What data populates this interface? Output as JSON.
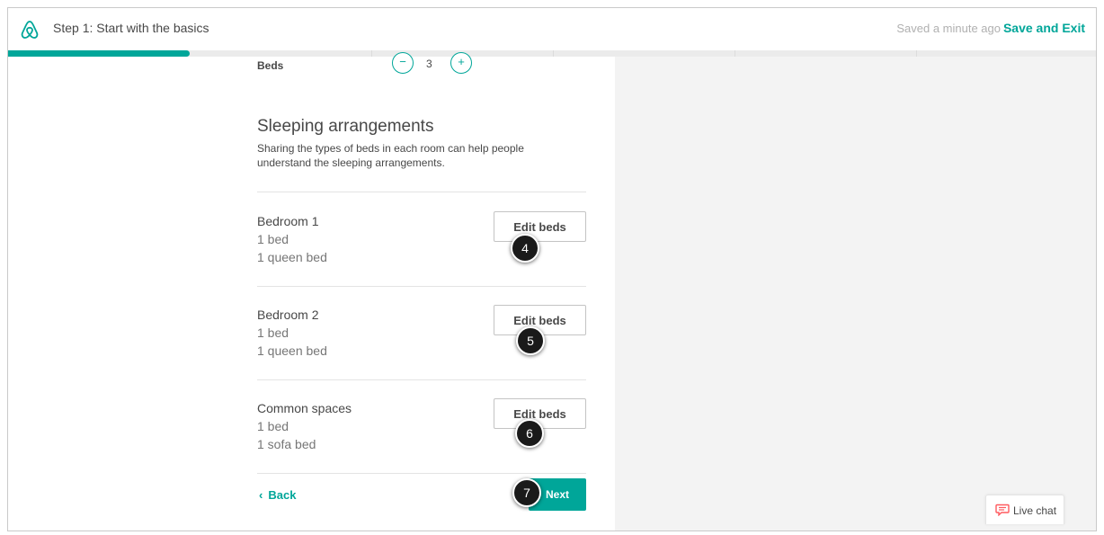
{
  "header": {
    "step_title": "Step 1: Start with the basics",
    "saved_status": "Saved a minute ago",
    "separator": "·",
    "save_exit_label": "Save and Exit"
  },
  "progress": {
    "fraction": 0.167
  },
  "beds": {
    "label": "Beds",
    "minus": "−",
    "value": "3",
    "plus": "+"
  },
  "sleeping": {
    "title": "Sleeping arrangements",
    "description": "Sharing the types of beds in each room can help people understand the sleeping arrangements.",
    "rooms": [
      {
        "name": "Bedroom 1",
        "line1": "1 bed",
        "line2": "1 queen bed",
        "button": "Edit beds",
        "callout": "4"
      },
      {
        "name": "Bedroom 2",
        "line1": "1 bed",
        "line2": "1 queen bed",
        "button": "Edit beds",
        "callout": "5"
      },
      {
        "name": "Common spaces",
        "line1": "1 bed",
        "line2": "1 sofa bed",
        "button": "Edit beds",
        "callout": "6"
      }
    ]
  },
  "footer": {
    "back_chevron": "‹",
    "back_label": "Back",
    "next_label": "Next",
    "next_callout": "7"
  },
  "live_chat": {
    "label": "Live chat"
  },
  "colors": {
    "accent": "#00a699",
    "brand": "#ff5a5f",
    "text": "#484848",
    "muted": "#767676"
  },
  "icons": {
    "logo": "airbnb-logo-icon",
    "chat": "chat-bubble-icon",
    "back": "chevron-left-icon"
  }
}
